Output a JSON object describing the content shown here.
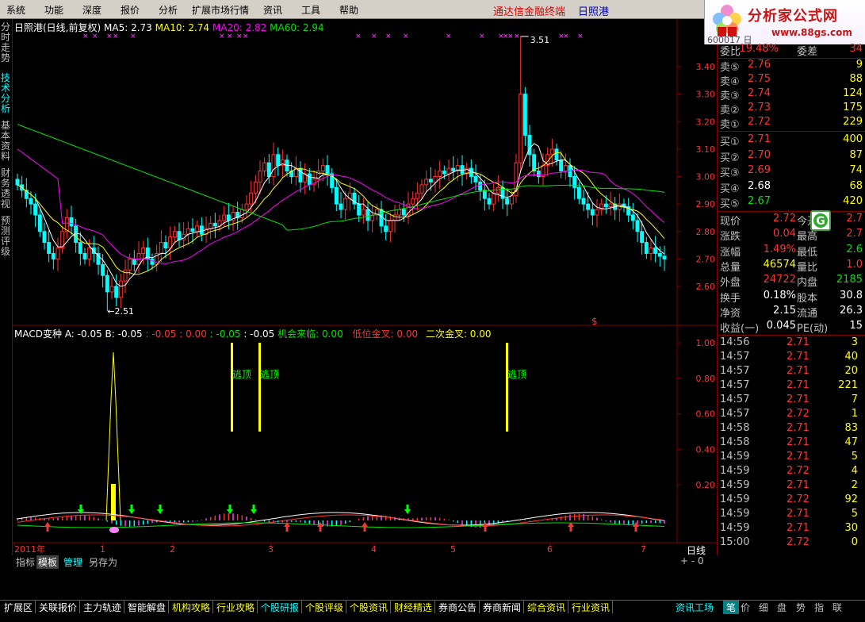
{
  "menu": [
    "系统",
    "功能",
    "深度",
    "报价",
    "分析",
    "扩展市场行情",
    "资讯",
    "工具",
    "帮助"
  ],
  "brand": {
    "title": "通达信金融终端",
    "stock": "日照港"
  },
  "logo": {
    "title": "分析家公式网",
    "url": "www.88gs.com"
  },
  "header_partial": "600017 日照港",
  "left_tabs": [
    "分时走势",
    "技术分析",
    "基本资料",
    "财务透视",
    "预测评级"
  ],
  "price_chart": {
    "title": "日照港(日线,前复权)",
    "ma5_label": "MA5: 2.73",
    "ma10_label": "MA10: 2.74",
    "ma20_label": "MA20: 2.82",
    "ma60_label": "MA60: 2.94",
    "y_ticks": [
      "3.40",
      "3.30",
      "3.20",
      "3.10",
      "3.00",
      "2.90",
      "2.80",
      "2.70",
      "2.60"
    ],
    "high_label": "3.51",
    "low_label": "←2.51",
    "marker": "$"
  },
  "macd_chart": {
    "title": "MACD变种",
    "a_label": "A: -0.05",
    "b_label": "B: -0.05",
    "c1": ": -0.05",
    "c2": ": 0.00",
    "c3": ": -0.05",
    "c4": ": -0.05",
    "opportunity": "机会来临: 0.00",
    "low_cross": "低位金叉: 0.00",
    "second_cross": "二次金叉: 0.00",
    "escape_label": "逃顶",
    "y_ticks": [
      "1.00",
      "0.80",
      "0.60",
      "0.40",
      "0.20"
    ]
  },
  "x_axis": {
    "labels": [
      "2011年",
      "1",
      "2",
      "3",
      "4",
      "5",
      "6",
      "7"
    ],
    "period": "日线"
  },
  "indicator_tabs": [
    "指标",
    "模板",
    "管理",
    "另存为"
  ],
  "scroll_ctrls": "+ - 0",
  "quote": {
    "weibi_label": "委比",
    "weibi_value": "19.48%",
    "weicha_label": "委差",
    "weicha_value": "34",
    "asks": [
      {
        "label": "卖⑤",
        "price": "2.76",
        "vol": "9"
      },
      {
        "label": "卖④",
        "price": "2.75",
        "vol": "88"
      },
      {
        "label": "卖③",
        "price": "2.74",
        "vol": "124"
      },
      {
        "label": "卖②",
        "price": "2.73",
        "vol": "175"
      },
      {
        "label": "卖①",
        "price": "2.72",
        "vol": "229"
      }
    ],
    "bids": [
      {
        "label": "买①",
        "price": "2.71",
        "vol": "400"
      },
      {
        "label": "买②",
        "price": "2.70",
        "vol": "87"
      },
      {
        "label": "买③",
        "price": "2.69",
        "vol": "74"
      },
      {
        "label": "买④",
        "price": "2.68",
        "vol": "68"
      },
      {
        "label": "买⑤",
        "price": "2.67",
        "vol": "420"
      }
    ],
    "stats": [
      {
        "l1": "现价",
        "v1": "2.72",
        "l2": "今开",
        "v2": "2.7"
      },
      {
        "l1": "涨跌",
        "v1": "0.04",
        "l2": "最高",
        "v2": "2.7"
      },
      {
        "l1": "涨幅",
        "v1": "1.49%",
        "l2": "最低",
        "v2": "2.6"
      },
      {
        "l1": "总量",
        "v1": "46574",
        "l2": "量比",
        "v2": "1.0"
      },
      {
        "l1": "外盘",
        "v1": "24722",
        "l2": "内盘",
        "v2": "2185"
      },
      {
        "l1": "换手",
        "v1": "0.18%",
        "l2": "股本",
        "v2": "30.8"
      },
      {
        "l1": "净资",
        "v1": "2.15",
        "l2": "流通",
        "v2": "26.3"
      },
      {
        "l1": "收益(一)",
        "v1": "0.045",
        "l2": "PE(动)",
        "v2": "15"
      }
    ],
    "ticks": [
      {
        "time": "14:56",
        "price": "2.71",
        "vol": "3"
      },
      {
        "time": "14:57",
        "price": "2.71",
        "vol": "40"
      },
      {
        "time": "14:57",
        "price": "2.71",
        "vol": "20"
      },
      {
        "time": "14:57",
        "price": "2.71",
        "vol": "221"
      },
      {
        "time": "14:57",
        "price": "2.71",
        "vol": "7"
      },
      {
        "time": "14:57",
        "price": "2.72",
        "vol": "1"
      },
      {
        "time": "14:58",
        "price": "2.71",
        "vol": "83"
      },
      {
        "time": "14:58",
        "price": "2.71",
        "vol": "47"
      },
      {
        "time": "14:59",
        "price": "2.71",
        "vol": "5"
      },
      {
        "time": "14:59",
        "price": "2.72",
        "vol": "4"
      },
      {
        "time": "14:59",
        "price": "2.71",
        "vol": "2"
      },
      {
        "time": "14:59",
        "price": "2.72",
        "vol": "92"
      },
      {
        "time": "14:59",
        "price": "2.71",
        "vol": "5"
      },
      {
        "time": "14:59",
        "price": "2.71",
        "vol": "30"
      },
      {
        "time": "15:00",
        "price": "2.72",
        "vol": "0"
      }
    ]
  },
  "bottom_tabs": [
    {
      "label": "扩展区",
      "color": "#ffffff"
    },
    {
      "label": "关联报价",
      "color": "#ffffff"
    },
    {
      "label": "主力轨迹",
      "color": "#ffffff"
    },
    {
      "label": "智能解盘",
      "color": "#ffffff"
    },
    {
      "label": "机构攻略",
      "color": "#ffff00"
    },
    {
      "label": "行业攻略",
      "color": "#ffff00"
    },
    {
      "label": "个股研报",
      "color": "#00ffff"
    },
    {
      "label": "个股评级",
      "color": "#ffff00"
    },
    {
      "label": "个股资讯",
      "color": "#ffff00"
    },
    {
      "label": "财经精选",
      "color": "#ffff00"
    },
    {
      "label": "券商公告",
      "color": "#ffffff"
    },
    {
      "label": "券商新闻",
      "color": "#ffffff"
    },
    {
      "label": "综合资讯",
      "color": "#ffff00"
    },
    {
      "label": "行业资讯",
      "color": "#ffff00"
    }
  ],
  "right_mini_tabs": [
    "资讯工场",
    "笔",
    "价",
    "细",
    "盘",
    "势",
    "指",
    "联"
  ],
  "colors": {
    "up": "#ff3232",
    "down": "#00ffff",
    "ma5": "#ffffff",
    "ma10": "#ffff00",
    "ma20": "#ff00ff",
    "ma60": "#00e600",
    "grid": "#800000",
    "axis_text": "#ff3232"
  }
}
